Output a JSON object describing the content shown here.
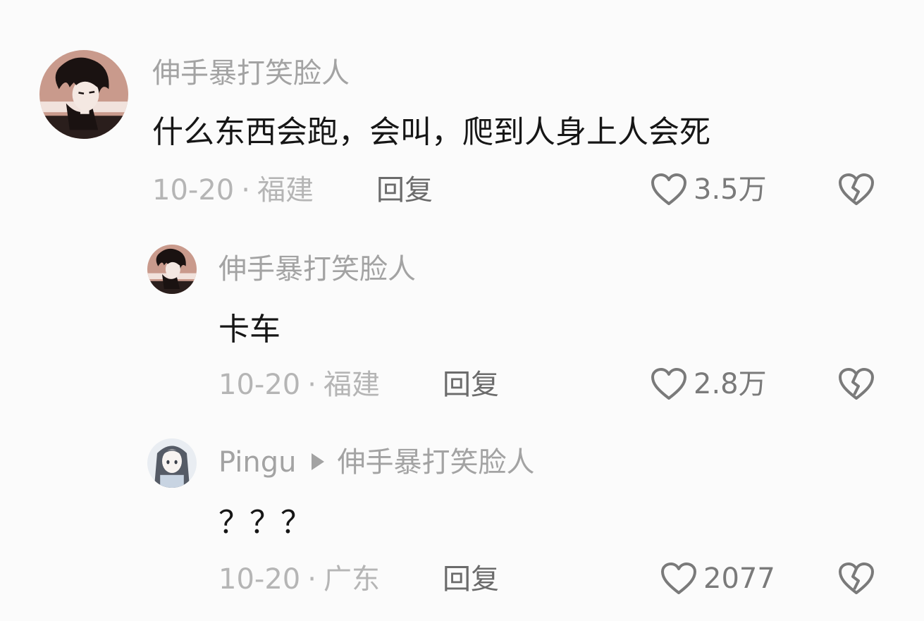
{
  "comments": [
    {
      "username": "伸手暴打笑脸人",
      "content": "什么东西会跑，会叫，爬到人身上人会死",
      "date": "10-20",
      "location": "福建",
      "reply_label": "回复",
      "likes": "3.5万",
      "avatar": "manga-avatar"
    },
    {
      "username": "伸手暴打笑脸人",
      "content": "卡车",
      "date": "10-20",
      "location": "福建",
      "reply_label": "回复",
      "likes": "2.8万",
      "avatar": "manga-avatar"
    },
    {
      "username": "Pingu",
      "reply_to": "伸手暴打笑脸人",
      "content": "？？？",
      "date": "10-20",
      "location": "广东",
      "reply_label": "回复",
      "likes": "2077",
      "avatar": "anime-girl-avatar"
    }
  ],
  "separator": "·",
  "icons": {
    "like": "heart-outline-icon",
    "dislike": "broken-heart-icon"
  },
  "colors": {
    "background": "#fbfbfb",
    "text": "#161616",
    "username": "#a3a3a3",
    "meta": "#b5b5b5"
  }
}
